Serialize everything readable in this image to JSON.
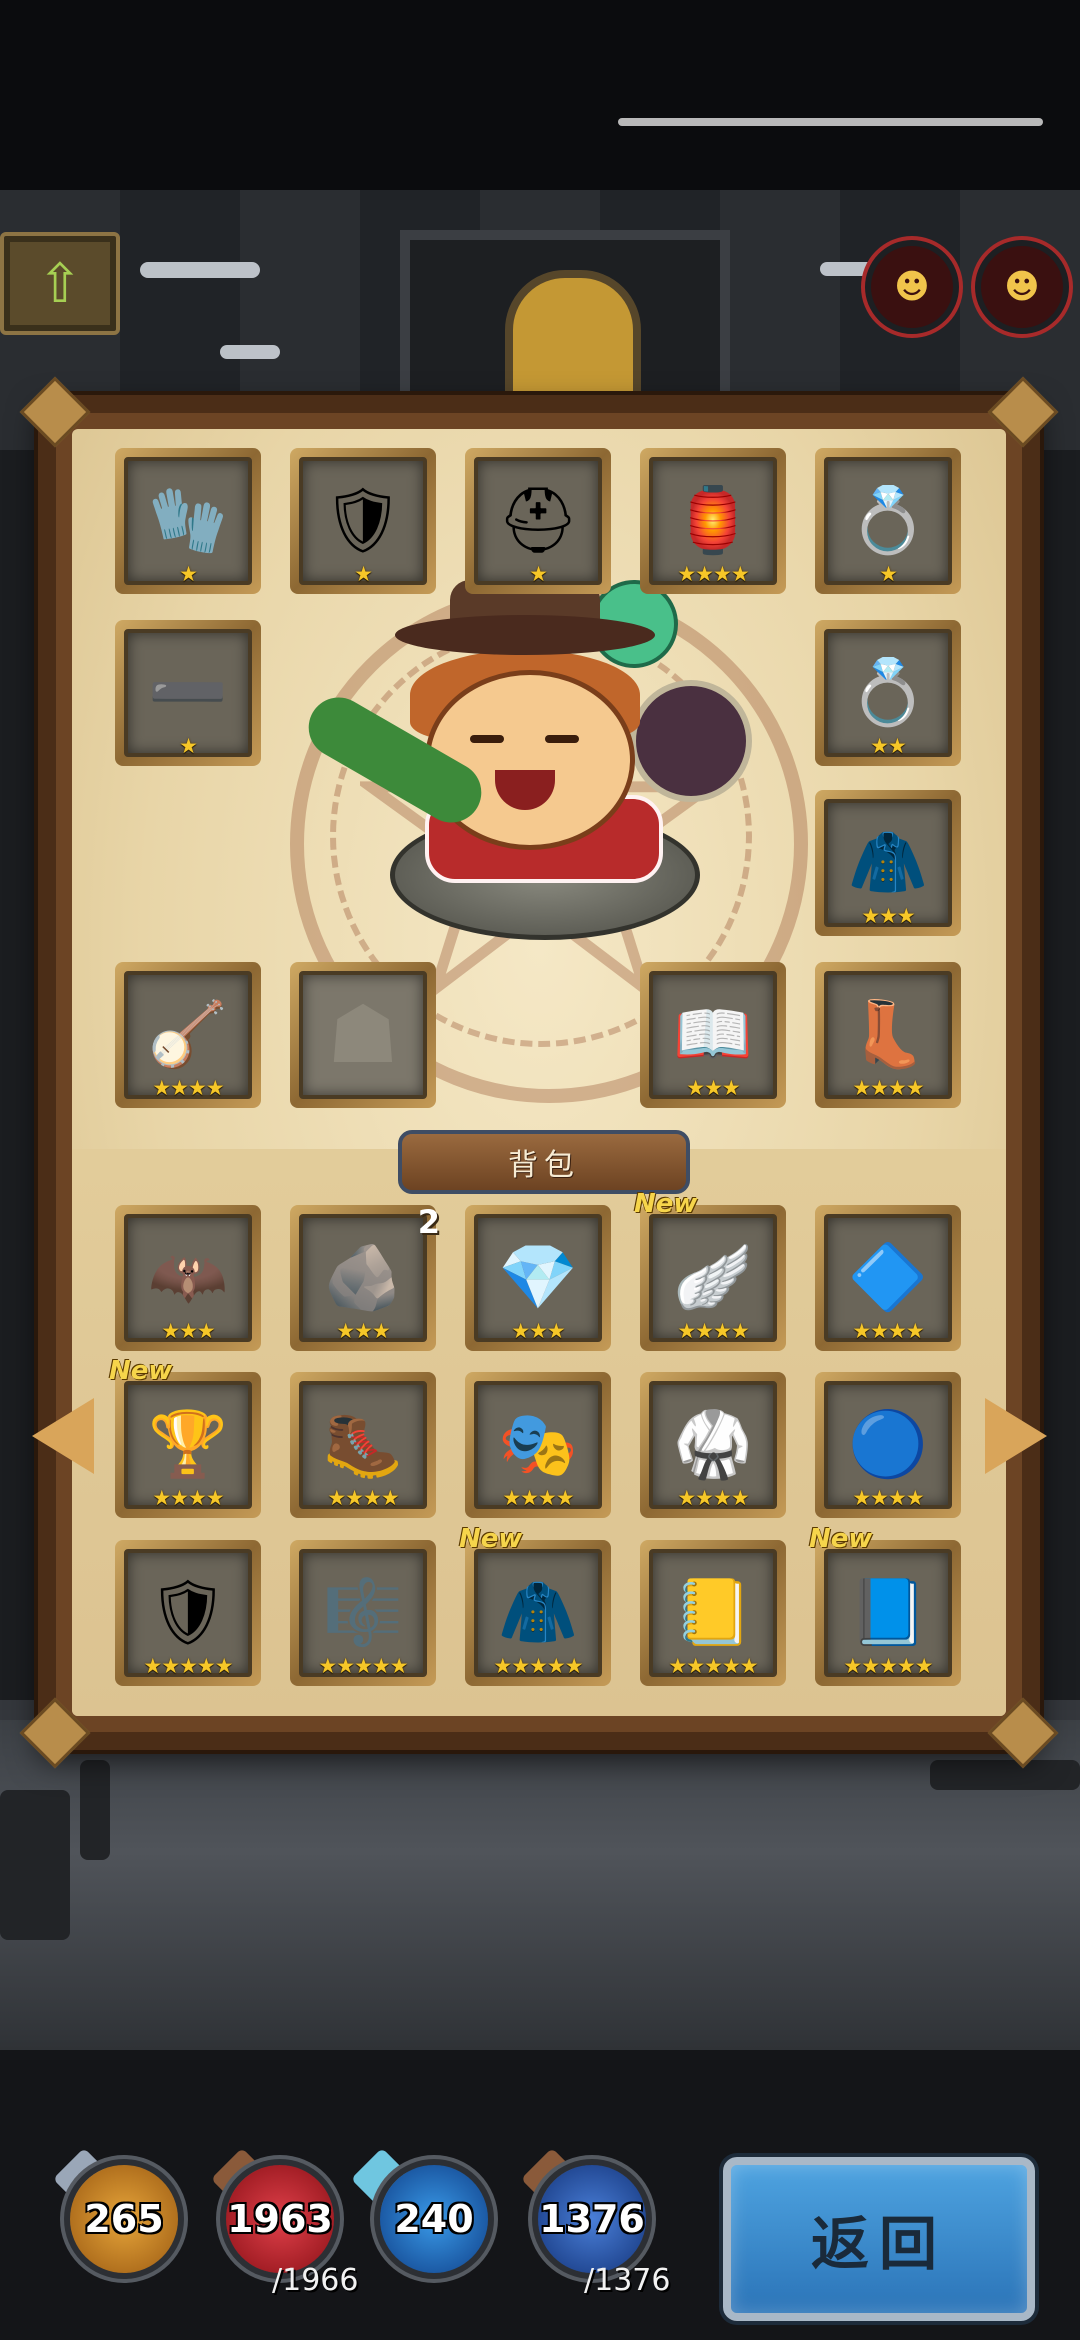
{
  "equipment": {
    "row1": [
      {
        "name": "gauntlets",
        "stars": "★",
        "icon": "🧤"
      },
      {
        "name": "chest-armor",
        "stars": "★",
        "icon": "🛡"
      },
      {
        "name": "winged-helmet",
        "stars": "★",
        "icon": "⛑"
      },
      {
        "name": "purple-lantern",
        "stars": "★★★★",
        "icon": "🏮"
      },
      {
        "name": "sapphire-ring",
        "stars": "★",
        "icon": "💍"
      }
    ],
    "row2_left": {
      "name": "belt",
      "stars": "★",
      "icon": "➖"
    },
    "row2_right": {
      "name": "emerald-ring",
      "stars": "★★",
      "icon": "💍"
    },
    "row3_right": {
      "name": "fur-cloak",
      "stars": "★★★",
      "icon": "🧥"
    },
    "row4": [
      {
        "name": "lute",
        "stars": "★★★★",
        "icon": "🪕"
      },
      {
        "name": "empty-slot",
        "stars": "",
        "icon": ""
      },
      {
        "name": "spellbook",
        "stars": "★★★",
        "icon": "📖"
      },
      {
        "name": "purple-boots",
        "stars": "★★★★",
        "icon": "👢"
      }
    ]
  },
  "bag": {
    "title": "背包",
    "rows": [
      [
        {
          "name": "purple-cape",
          "stars": "★★★",
          "icon": "🦇",
          "new": "",
          "qty": ""
        },
        {
          "name": "rune-stone",
          "stars": "★★★",
          "icon": "🪨",
          "new": "",
          "qty": "2"
        },
        {
          "name": "pink-gem-amulet",
          "stars": "★★★",
          "icon": "💎",
          "new": "",
          "qty": ""
        },
        {
          "name": "golden-wing-helm",
          "stars": "★★★★",
          "icon": "🪽",
          "new": "New",
          "qty": ""
        },
        {
          "name": "gem-bracer",
          "stars": "★★★★",
          "icon": "🔷",
          "new": "",
          "qty": ""
        }
      ],
      [
        {
          "name": "golden-pauldrons",
          "stars": "★★★★",
          "icon": "🏆",
          "new": "New",
          "qty": ""
        },
        {
          "name": "plated-boots",
          "stars": "★★★★",
          "icon": "🥾",
          "new": "",
          "qty": ""
        },
        {
          "name": "purple-hood",
          "stars": "★★★★",
          "icon": "🎭",
          "new": "",
          "qty": ""
        },
        {
          "name": "blue-robe",
          "stars": "★★★★",
          "icon": "🥋",
          "new": "",
          "qty": ""
        },
        {
          "name": "blue-orb",
          "stars": "★★★★",
          "icon": "🔵",
          "new": "",
          "qty": ""
        }
      ],
      [
        {
          "name": "royal-armor",
          "stars": "★★★★★",
          "icon": "🛡",
          "new": "",
          "qty": ""
        },
        {
          "name": "harp",
          "stars": "★★★★★",
          "icon": "🎼",
          "new": "",
          "qty": ""
        },
        {
          "name": "green-cloak",
          "stars": "★★★★★",
          "icon": "🧥",
          "new": "New",
          "qty": ""
        },
        {
          "name": "golden-tome",
          "stars": "★★★★★",
          "icon": "📒",
          "new": "",
          "qty": ""
        },
        {
          "name": "crystal-book",
          "stars": "★★★★★",
          "icon": "📘",
          "new": "New",
          "qty": ""
        }
      ]
    ]
  },
  "resources": {
    "attack": {
      "value": "265",
      "color": "#c9861e"
    },
    "hp": {
      "value": "1963",
      "max": "/1966",
      "color": "#c0202a"
    },
    "magic": {
      "value": "240",
      "color": "#1f6fc9"
    },
    "mana": {
      "value": "1376",
      "max": "/1376",
      "color": "#2a5fb0"
    }
  },
  "back_button": "返回",
  "colors": {
    "star": "#f6c728",
    "new": "#f6d54b",
    "parchment": "#efdfb8"
  }
}
